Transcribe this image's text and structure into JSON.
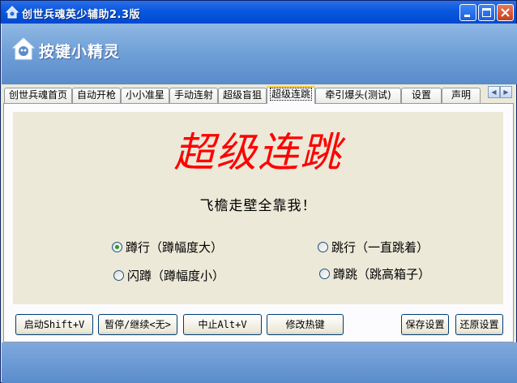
{
  "window": {
    "title": "创世兵魂英少辅助2.3版"
  },
  "header": {
    "logo_text": "按键小精灵"
  },
  "tabs": [
    {
      "label": "创世兵魂首页"
    },
    {
      "label": "自动开枪"
    },
    {
      "label": "小小准星"
    },
    {
      "label": "手动连射"
    },
    {
      "label": "超级盲狙"
    },
    {
      "label": "超级连跳",
      "active": true
    },
    {
      "label": "牵引爆头(测试)"
    },
    {
      "label": "设置"
    },
    {
      "label": "声明"
    }
  ],
  "main": {
    "title": "超级连跳",
    "slogan": "飞檐走壁全靠我！",
    "options": [
      {
        "label": "蹲行（蹲幅度大）",
        "checked": true
      },
      {
        "label": "跳行（一直跳着）",
        "checked": false
      },
      {
        "label": "闪蹲（蹲幅度小）",
        "checked": false
      },
      {
        "label": "蹲跳（跳高箱子）",
        "checked": false
      }
    ]
  },
  "buttons": {
    "start": "启动Shift+V",
    "pause": "暂停/继续<无>",
    "stop": "中止Alt+V",
    "hotkey": "修改热键",
    "save": "保存设置",
    "restore": "还原设置"
  },
  "colors": {
    "title_text": "#ff0000",
    "titlebar": "#0a5ae0",
    "header": "#6f9fd6",
    "radio_checked": "#21a121"
  },
  "icons": {
    "app": "app-icon",
    "logo": "logo-icon",
    "tab_prev": "tab-scroll-left-icon",
    "tab_next": "tab-scroll-right-icon"
  }
}
